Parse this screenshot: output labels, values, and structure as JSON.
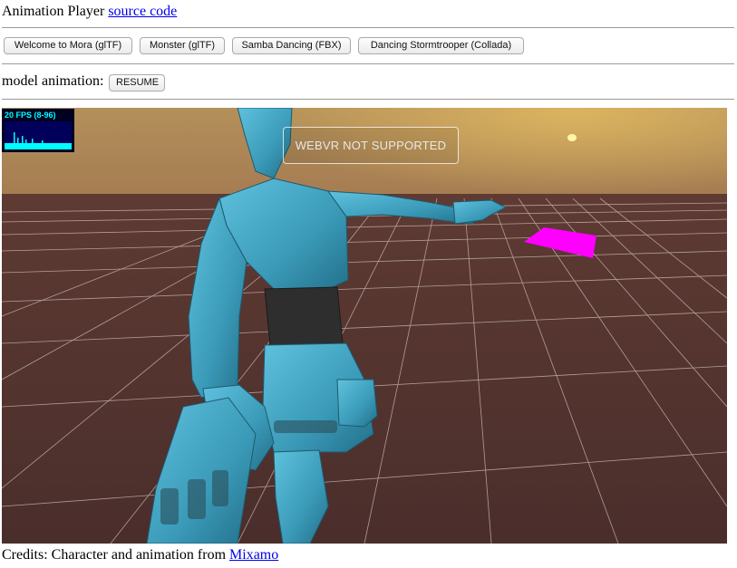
{
  "header": {
    "title": "Animation Player",
    "source_link": "source code"
  },
  "models": [
    {
      "label": "Welcome to Mora (glTF)"
    },
    {
      "label": "Monster (glTF)"
    },
    {
      "label": "Samba Dancing (FBX)"
    },
    {
      "label": "Dancing Stormtrooper (Collada)"
    }
  ],
  "animation": {
    "label": "model animation:",
    "button": "RESUME"
  },
  "stats": {
    "fps_text": "20 FPS (8-96)",
    "fill_color": "#00ffff",
    "bg_color": "#000021"
  },
  "scene": {
    "webvr_message": "WEBVR NOT SUPPORTED",
    "character_color": "#3a9ab8",
    "box_color": "#ff00ff"
  },
  "credits": {
    "text": "Credits: Character and animation from",
    "link": "Mixamo"
  }
}
